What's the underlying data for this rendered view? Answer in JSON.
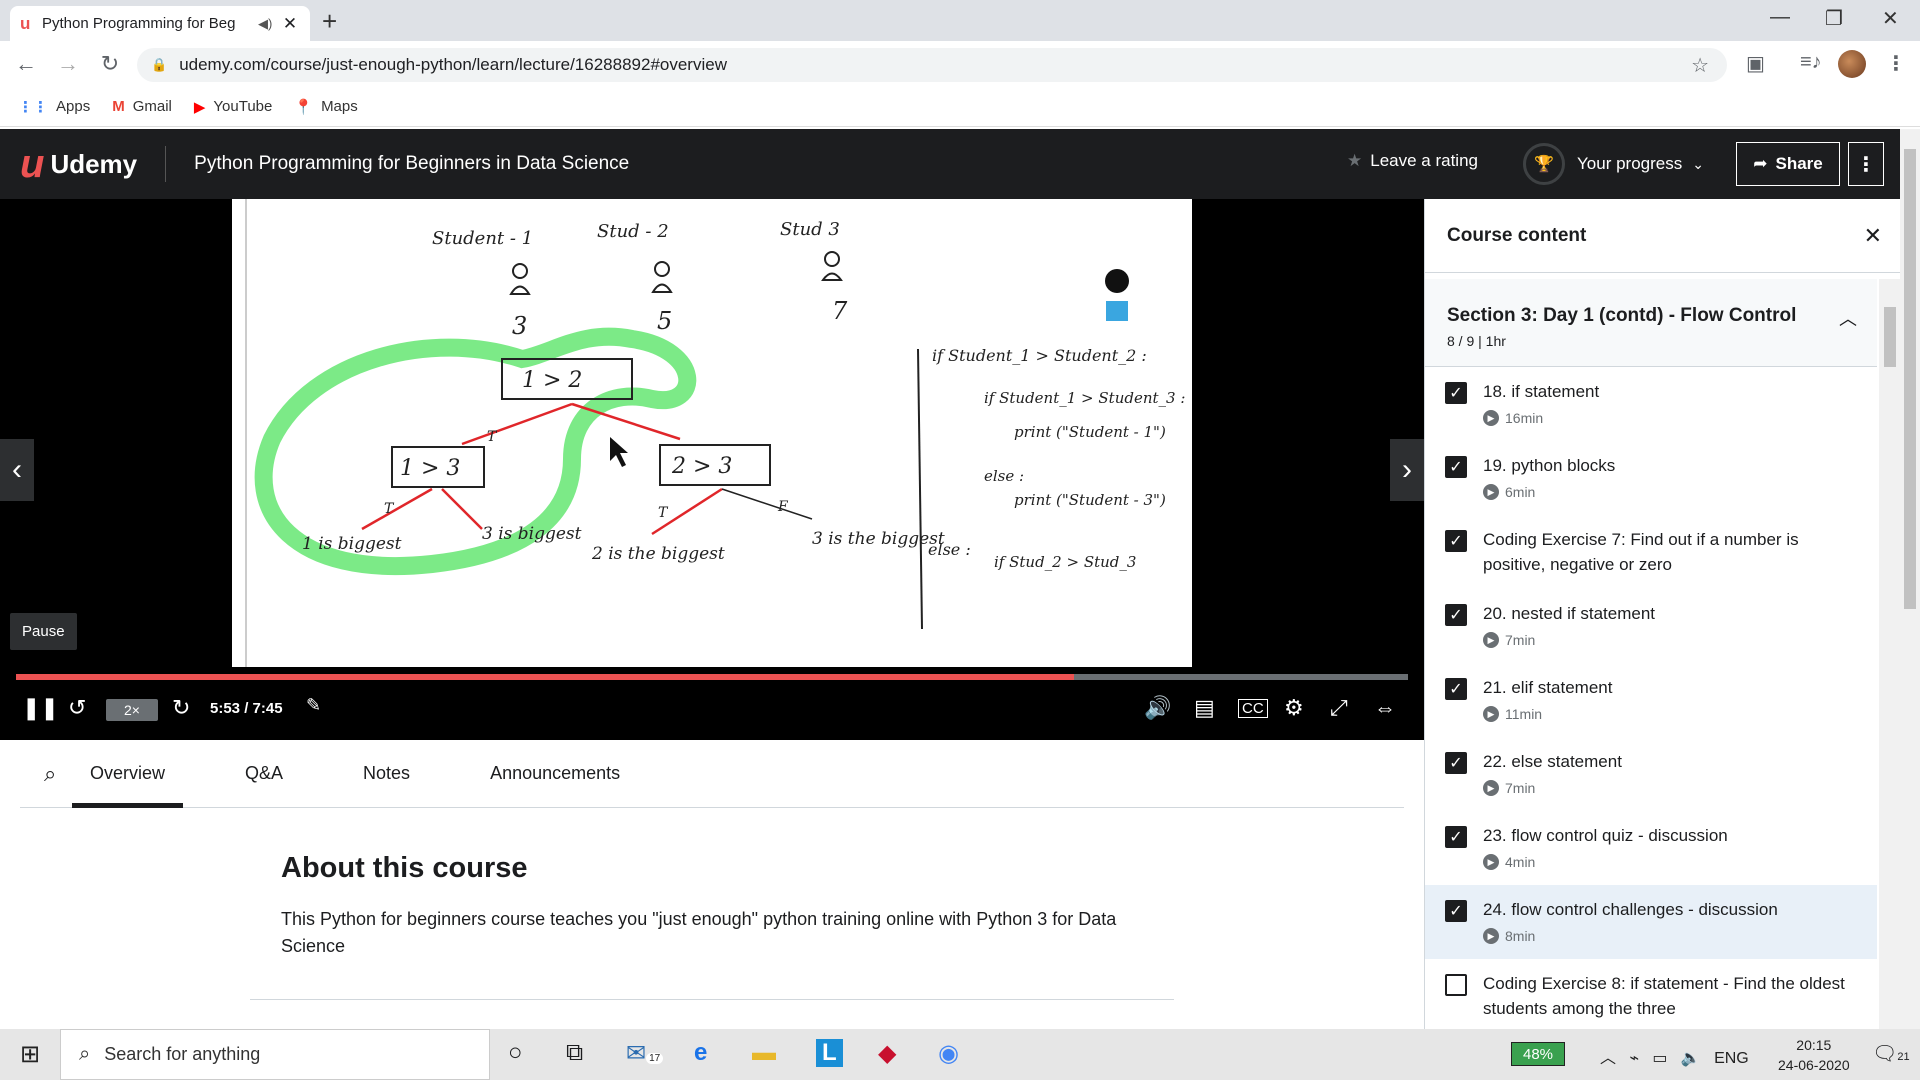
{
  "browser": {
    "tab_title": "Python Programming for Beg",
    "url": "udemy.com/course/just-enough-python/learn/lecture/16288892#overview",
    "bookmarks": [
      "Apps",
      "Gmail",
      "YouTube",
      "Maps"
    ]
  },
  "header": {
    "logo_text": "Udemy",
    "course_title": "Python Programming for Beginners in Data Science",
    "rating_label": "Leave a rating",
    "progress_label": "Your progress",
    "share_label": "Share"
  },
  "player": {
    "pause_tooltip": "Pause",
    "speed": "2×",
    "timecode": "5:53 / 7:45",
    "progress_fraction": 0.76,
    "slide": {
      "students": [
        "Student - 1",
        "Stud - 2",
        "Stud 3"
      ],
      "scores": [
        "3",
        "5",
        "7"
      ],
      "root_node": "1 > 2",
      "left_node": "1 > 3",
      "right_node": "2 > 3",
      "leaves": [
        "1 is biggest",
        "3 is biggest",
        "2 is the biggest",
        "3 is the biggest"
      ],
      "code_lines": [
        "if Student_1 > Student_2 :",
        "if Student_1 > Student_3 :",
        "print (\"Student - 1\")",
        "else :",
        "print (\"Student - 3\")",
        "else :",
        "if Stud_2 > Stud_3"
      ]
    }
  },
  "tabs": [
    "Overview",
    "Q&A",
    "Notes",
    "Announcements"
  ],
  "about": {
    "heading": "About this course",
    "description": "This Python for beginners course teaches you \"just enough\" python training online with Python 3 for Data Science"
  },
  "sidebar": {
    "title": "Course content",
    "section_title": "Section 3: Day 1 (contd) - Flow Control",
    "section_meta": "8 / 9 | 1hr",
    "lessons": [
      {
        "title": "18. if statement",
        "duration": "16min",
        "done": true
      },
      {
        "title": "19. python blocks",
        "duration": "6min",
        "done": true
      },
      {
        "title": "Coding Exercise 7: Find out if a number is positive, negative or zero",
        "duration": "",
        "done": true
      },
      {
        "title": "20. nested if statement",
        "duration": "7min",
        "done": true
      },
      {
        "title": "21. elif statement",
        "duration": "11min",
        "done": true
      },
      {
        "title": "22. else statement",
        "duration": "7min",
        "done": true
      },
      {
        "title": "23. flow control quiz - discussion",
        "duration": "4min",
        "done": true
      },
      {
        "title": "24. flow control challenges - discussion",
        "duration": "8min",
        "done": true,
        "current": true
      },
      {
        "title": "Coding Exercise 8: if statement - Find the oldest students among the three",
        "duration": "",
        "done": false
      }
    ]
  },
  "taskbar": {
    "search_placeholder": "Search for anything",
    "battery": "48%",
    "language": "ENG",
    "time": "20:15",
    "date": "24-06-2020",
    "mail_badge": "17",
    "notif_count": "21"
  },
  "colors": {
    "accent": "#ec5252",
    "header_bg": "#1c1d1f",
    "highlight": "#6ee87a"
  }
}
